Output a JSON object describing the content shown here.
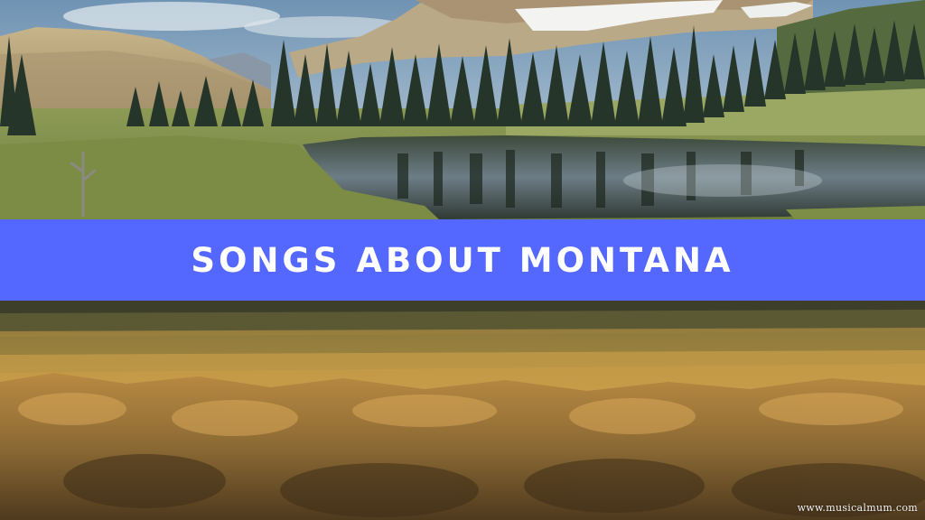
{
  "banner": {
    "title": "SONGS ABOUT MONTANA",
    "background_color": "#5468ff",
    "text_color": "#ffffff"
  },
  "top_image": {
    "scene": "mountain lake with pine forest and snowy peaks"
  },
  "bottom_image": {
    "scene": "golden prairie grassland with sagebrush"
  },
  "watermark": {
    "text": "www.musicalmum.com"
  }
}
